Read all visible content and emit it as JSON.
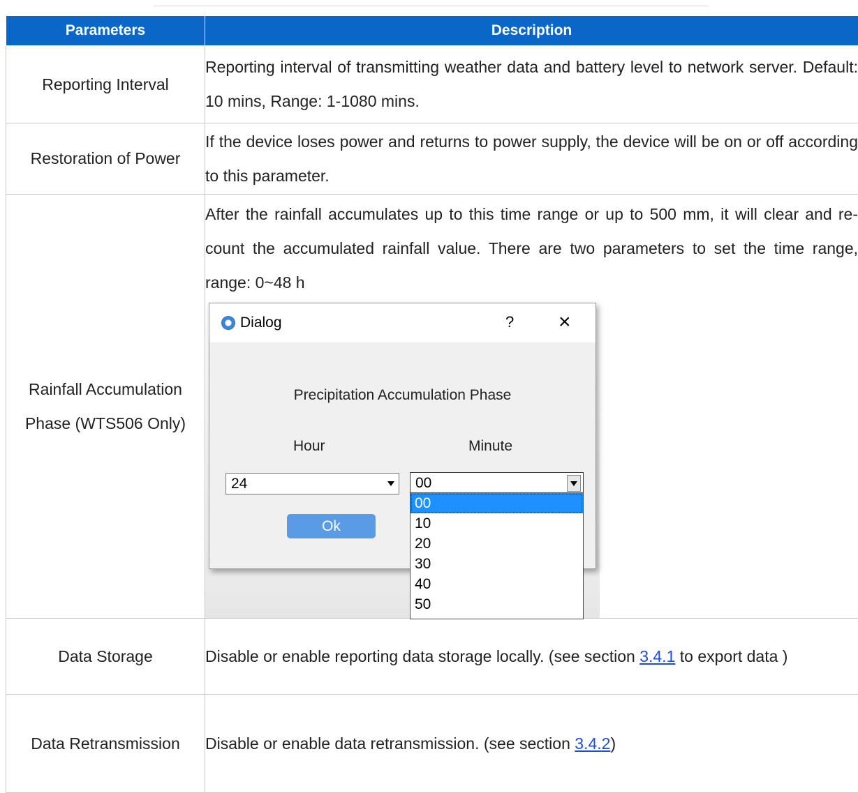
{
  "table": {
    "headers": {
      "parameters": "Parameters",
      "description": "Description"
    },
    "rows": [
      {
        "parameter": "Reporting Interval",
        "description": "Reporting interval of transmitting weather data and battery level to network server. Default: 10 mins, Range: 1-1080 mins."
      },
      {
        "parameter": "Restoration of Power",
        "description": "If the device loses power and returns to power supply, the device will be on or off according to this parameter."
      },
      {
        "parameter": "Rainfall Accumulation Phase (WTS506 Only)",
        "description": "After the rainfall accumulates up to this time range or up to 500 mm, it will clear and re-count the accumulated rainfall value. There are two parameters to set the time range, range: 0~48 h"
      },
      {
        "parameter": "Data Storage",
        "description_before": "Disable or enable reporting data storage locally. (see section ",
        "link": "3.4.1",
        "description_after": " to export data )"
      },
      {
        "parameter": "Data Retransmission",
        "description_before": "Disable or enable data retransmission. (see section ",
        "link": "3.4.2",
        "description_after": ")"
      }
    ]
  },
  "dialog": {
    "title": "Dialog",
    "help": "?",
    "close": "×",
    "heading": "Precipitation Accumulation Phase",
    "hour_label": "Hour",
    "minute_label": "Minute",
    "hour_value": "24",
    "minute_value": "00",
    "minute_options": [
      "00",
      "10",
      "20",
      "30",
      "40",
      "50"
    ],
    "selected_option": "00",
    "ok_label": "Ok"
  }
}
